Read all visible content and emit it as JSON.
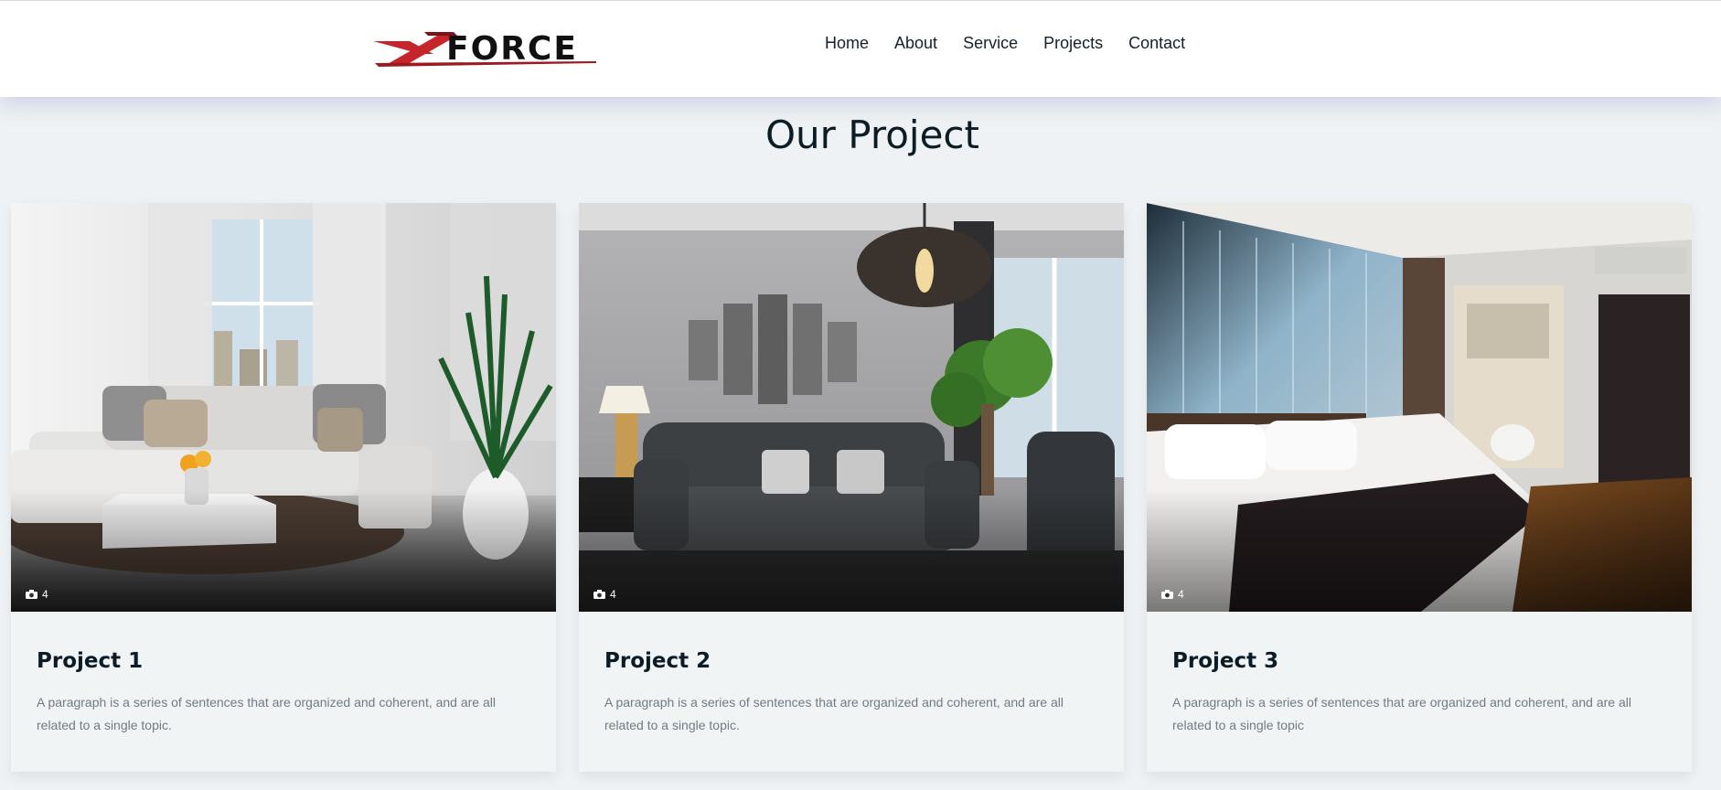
{
  "header": {
    "logo": {
      "text": "FORCE",
      "mark": "X",
      "mark_color": "#c6252c"
    },
    "nav": [
      {
        "label": "Home"
      },
      {
        "label": "About"
      },
      {
        "label": "Service"
      },
      {
        "label": "Projects"
      },
      {
        "label": "Contact"
      }
    ]
  },
  "page": {
    "title": "Our Project"
  },
  "projects": [
    {
      "title": "Project 1",
      "photo_count": "4",
      "description": "A paragraph is a series of sentences that are organized and coherent, and are all related to a single topic.",
      "image": "living-room-white-sofa"
    },
    {
      "title": "Project 2",
      "photo_count": "4",
      "description": "A paragraph is a series of sentences that are organized and coherent, and are all related to a single topic.",
      "image": "living-room-grey-chesterfield"
    },
    {
      "title": "Project 3",
      "photo_count": "4",
      "description": "A paragraph is a series of sentences that are organized and coherent, and are all related to a single topic",
      "image": "hotel-bedroom"
    }
  ],
  "colors": {
    "accent": "#c6252c",
    "heading": "#0b1c26",
    "body_text": "#6f7b85",
    "background": "#eef2f4"
  }
}
